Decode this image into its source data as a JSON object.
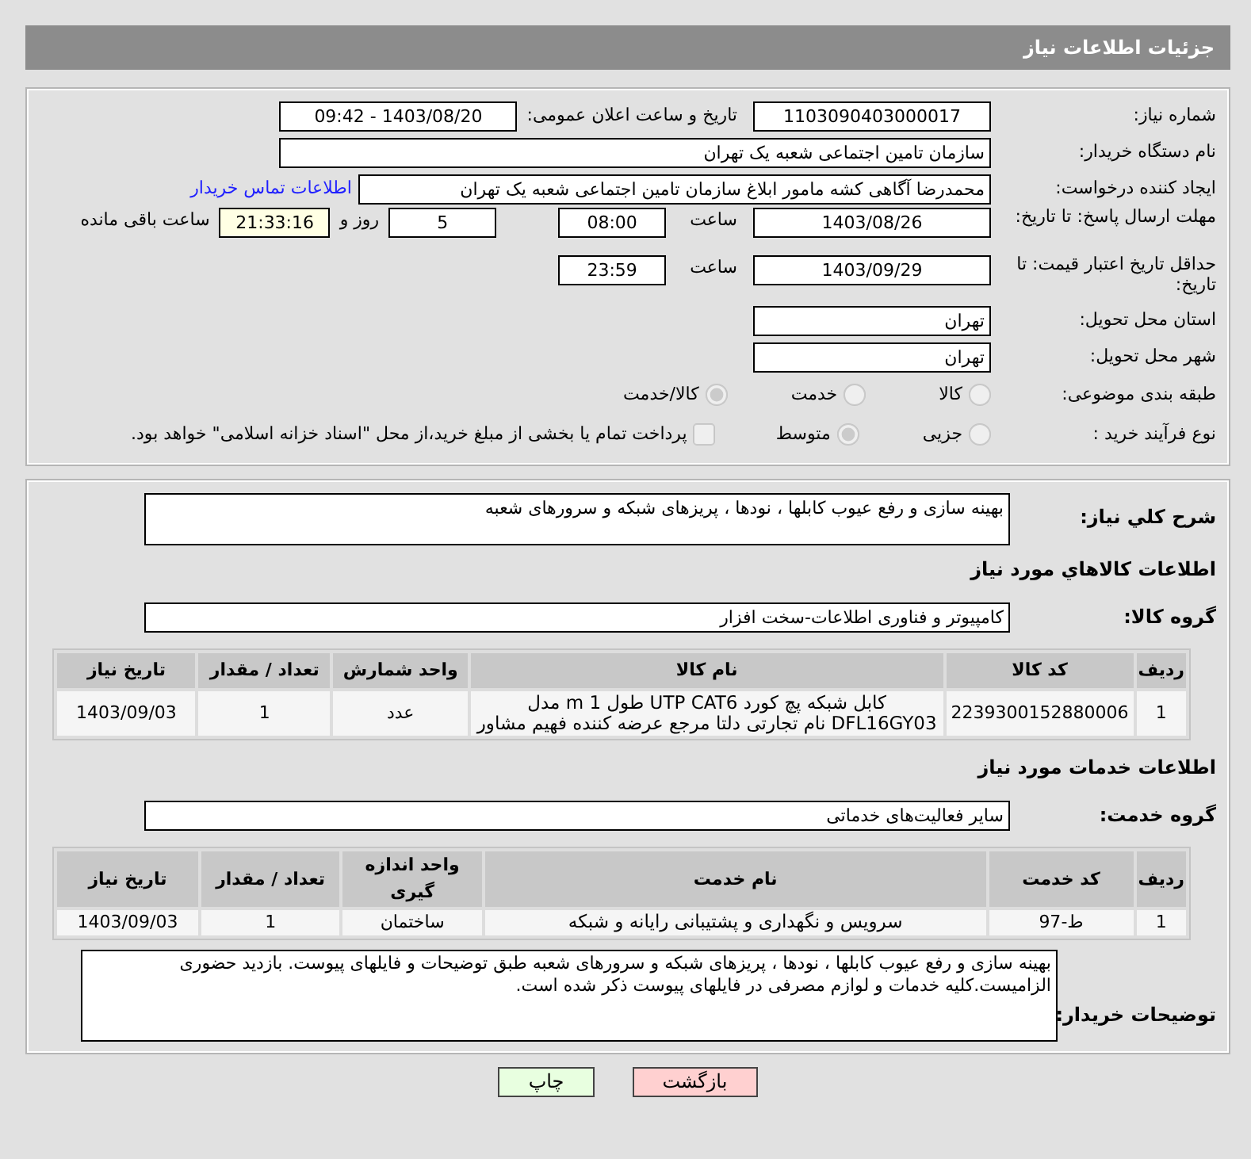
{
  "header": {
    "title": "جزئیات اطلاعات نیاز"
  },
  "info": {
    "need_number": {
      "label": "شماره نیاز:",
      "value": "1103090403000017"
    },
    "announce": {
      "label": "تاریخ و ساعت اعلان عمومی:",
      "value": "1403/08/20 - 09:42"
    },
    "buyer_org": {
      "label": "نام دستگاه خریدار:",
      "value": "سازمان تامین اجتماعی شعبه یک تهران"
    },
    "requester": {
      "label": "ایجاد کننده درخواست:",
      "value": "محمدرضا آگاهی کشه مامور ابلاغ  سازمان تامین اجتماعی شعبه یک تهران",
      "link": "اطلاعات تماس خریدار"
    },
    "reply_deadline": {
      "label": "مهلت ارسال پاسخ: تا تاریخ:",
      "date": "1403/08/26",
      "time_label": "ساعت",
      "time": "08:00",
      "days": "5",
      "days_label": "روز و",
      "remaining": "21:33:16",
      "remaining_label": "ساعت باقی مانده"
    },
    "price_validity": {
      "label": "حداقل تاریخ اعتبار قیمت: تا تاریخ:",
      "date": "1403/09/29",
      "time_label": "ساعت",
      "time": "23:59"
    },
    "province": {
      "label": "استان محل تحویل:",
      "value": "تهران"
    },
    "city": {
      "label": "شهر محل تحویل:",
      "value": "تهران"
    },
    "category": {
      "label": "طبقه بندی موضوعی:",
      "options": [
        {
          "label": "کالا",
          "selected": false
        },
        {
          "label": "خدمت",
          "selected": false
        },
        {
          "label": "کالا/خدمت",
          "selected": true
        }
      ]
    },
    "process": {
      "label": "نوع فرآیند خرید :",
      "options": [
        {
          "label": "جزیی",
          "selected": false
        },
        {
          "label": "متوسط",
          "selected": true
        }
      ],
      "treasury": {
        "label": "پرداخت تمام یا بخشی از مبلغ خرید،از محل \"اسناد خزانه اسلامی\" خواهد بود.",
        "checked": false
      }
    }
  },
  "details": {
    "summary": {
      "label": "شرح کلي نياز:",
      "value": "بهینه سازی و رفع عیوب کابلها ، نودها ، پریزهای شبکه و سرورهای شعبه"
    },
    "goods_heading": "اطلاعات كالاهاي مورد نياز",
    "goods_group": {
      "label": "گروه کالا:",
      "value": "کامپیوتر و فناوری اطلاعات-سخت افزار"
    },
    "goods_table": {
      "columns": [
        "ردیف",
        "کد کالا",
        "نام کالا",
        "واحد شمارش",
        "تعداد / مقدار",
        "تاریخ نیاز"
      ],
      "rows": [
        [
          "1",
          "2239300152880006",
          "کابل شبکه پچ کورد UTP CAT6 طول 1 m مدل DFL16GY03 نام تجارتی دلتا مرجع عرضه کننده فهیم مشاور",
          "عدد",
          "1",
          "1403/09/03"
        ]
      ]
    },
    "services_heading": "اطلاعات خدمات مورد نیاز",
    "service_group": {
      "label": "گروه خدمت:",
      "value": "سایر فعالیت‌های خدماتی"
    },
    "services_table": {
      "columns": [
        "ردیف",
        "کد خدمت",
        "نام خدمت",
        "واحد اندازه گیری",
        "تعداد / مقدار",
        "تاریخ نیاز"
      ],
      "rows": [
        [
          "1",
          "ط-97",
          "سرویس و نگهداری و پشتیبانی رایانه و شبکه",
          "ساختمان",
          "1",
          "1403/09/03"
        ]
      ]
    },
    "buyer_notes": {
      "label": "توضیحات خریدار:",
      "value": "بهینه سازی و رفع عیوب کابلها ، نودها ، پریزهای شبکه و سرورهای شعبه طبق توضیحات و فایلهای پیوست. بازدید حضوری الزامیست.کلیه خدمات و لوازم مصرفی در فایلهای پیوست ذکر شده است."
    }
  },
  "buttons": [
    {
      "label": "بازگشت",
      "kind": "back"
    },
    {
      "label": "چاپ",
      "kind": "print"
    }
  ]
}
